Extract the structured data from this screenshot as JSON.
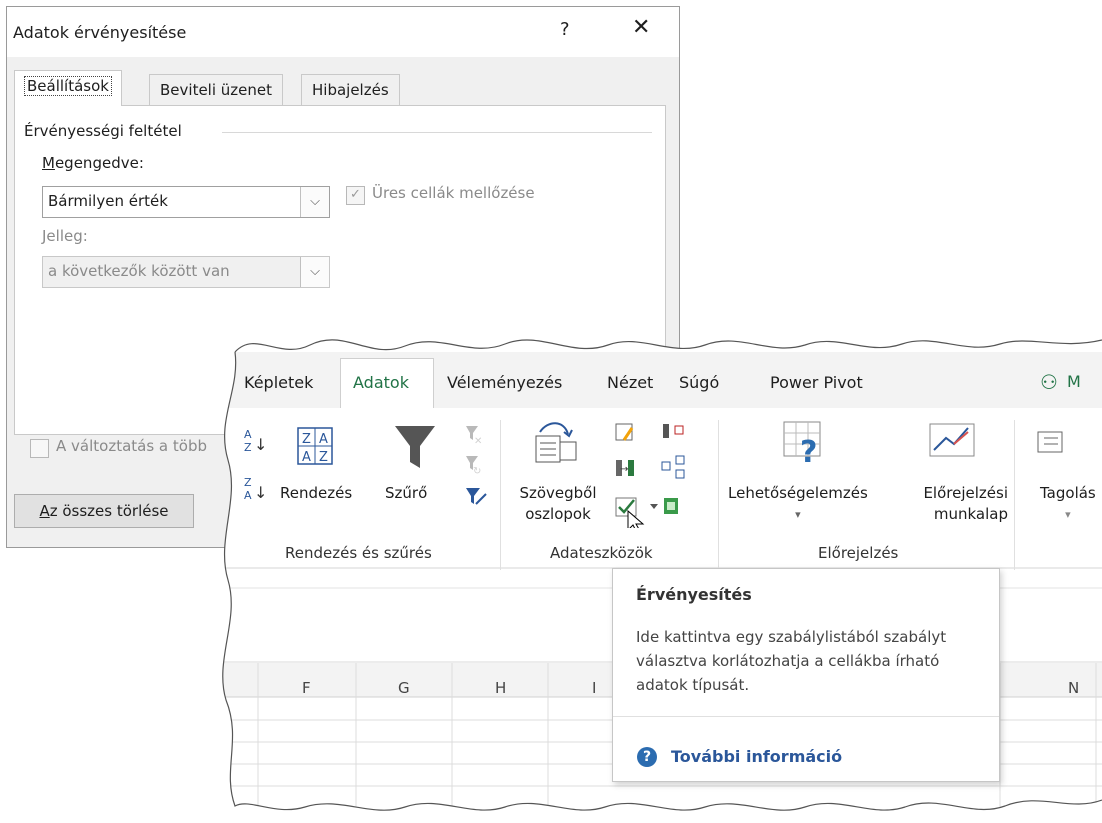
{
  "dialog": {
    "title": "Adatok érvényesítése",
    "help": "?",
    "close": "✕",
    "tabs": [
      "Beállítások",
      "Beviteli üzenet",
      "Hibajelzés"
    ],
    "criteria_label": "Érvényességi feltétel",
    "allow_label_underlined": "M",
    "allow_label_rest": "egengedve:",
    "allow_value": "Bármilyen érték",
    "ignore_blank_label": "Üres cellák mellőzése",
    "type_label": "Jelleg:",
    "type_value": "a következők között van",
    "apply_all_label": "A változtatás a több",
    "clear_underlined": "A",
    "clear_rest": "z összes törlése"
  },
  "ribbon": {
    "tabs": [
      "Képletek",
      "Adatok",
      "Véleményezés",
      "Nézet",
      "Súgó",
      "Power Pivot"
    ],
    "share_label": "M",
    "sort_label": "Rendezés",
    "filter_label": "Szűrő",
    "text_to_columns_line1": "Szövegből",
    "text_to_columns_line2": "oszlopok",
    "whatif_label": "Lehetőségelemzés",
    "forecast_line1": "Előrejelzési",
    "forecast_line2": "munkalap",
    "outline_label": "Tagolás",
    "groups": [
      "Rendezés és szűrés",
      "Adateszközök",
      "Előrejelzés"
    ]
  },
  "sheet": {
    "columns": [
      "F",
      "G",
      "H",
      "I",
      "N"
    ]
  },
  "tooltip": {
    "title": "Érvényesítés",
    "body": "Ide kattintva egy szabálylistából szabályt választva korlátozhatja a cellákba írható adatok típusát.",
    "link": "További információ"
  },
  "colors": {
    "accent_green": "#217346",
    "link_blue": "#2b579a"
  }
}
